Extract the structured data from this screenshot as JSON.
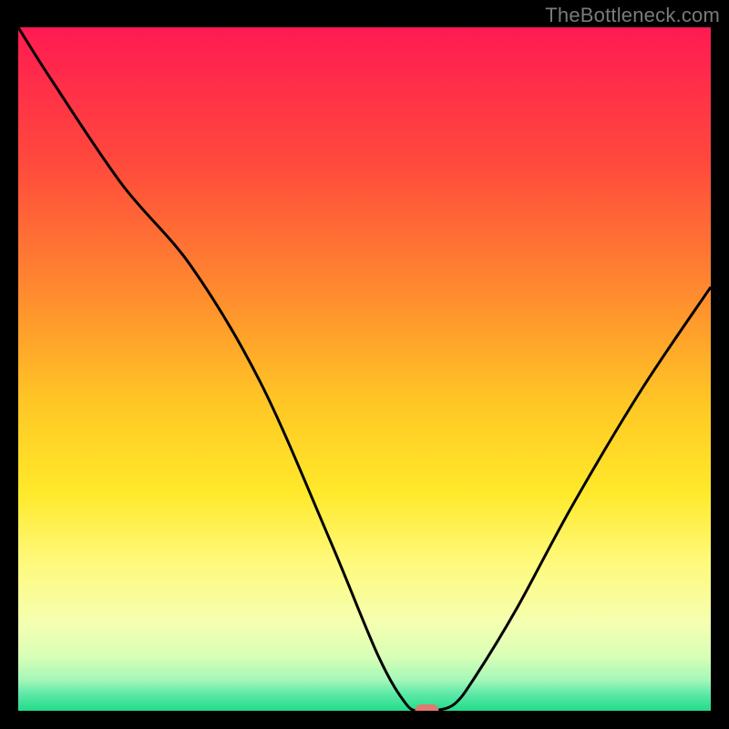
{
  "watermark": "TheBottleneck.com",
  "chart_data": {
    "type": "line",
    "title": "",
    "xlabel": "",
    "ylabel": "",
    "xlim": [
      0,
      100
    ],
    "ylim": [
      0,
      100
    ],
    "grid": false,
    "legend": false,
    "background": {
      "type": "vertical-gradient",
      "stops": [
        {
          "pos": 0.0,
          "color": "#ff1a52"
        },
        {
          "pos": 0.2,
          "color": "#ff4a3c"
        },
        {
          "pos": 0.4,
          "color": "#ff8f2e"
        },
        {
          "pos": 0.55,
          "color": "#ffc725"
        },
        {
          "pos": 0.68,
          "color": "#ffe92a"
        },
        {
          "pos": 0.78,
          "color": "#fff97a"
        },
        {
          "pos": 0.87,
          "color": "#f5ffb0"
        },
        {
          "pos": 0.92,
          "color": "#d9ffb6"
        },
        {
          "pos": 0.955,
          "color": "#a4f7b8"
        },
        {
          "pos": 0.975,
          "color": "#5ee9a8"
        },
        {
          "pos": 1.0,
          "color": "#22dc8a"
        }
      ]
    },
    "series": [
      {
        "name": "bottleneck-curve",
        "color": "#000000",
        "x": [
          0,
          5,
          15,
          25,
          35,
          45,
          52,
          56,
          58,
          60,
          63,
          66,
          72,
          80,
          90,
          100
        ],
        "y": [
          100,
          92,
          77,
          65,
          48,
          25,
          8,
          1,
          0,
          0,
          1,
          5,
          15,
          30,
          47,
          62
        ]
      }
    ],
    "marker": {
      "name": "optimal-point",
      "x": 59,
      "y": 0,
      "color": "#e07a6f",
      "shape": "pill"
    }
  }
}
